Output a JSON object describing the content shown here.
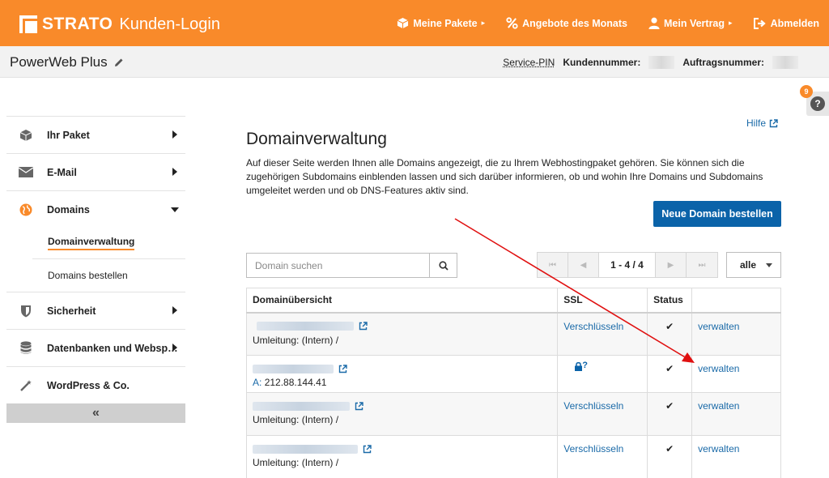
{
  "header": {
    "brand": "STRATO",
    "subtitle": "Kunden-Login",
    "nav": [
      {
        "label": "Meine Pakete",
        "icon": "package-icon",
        "has_chevron": true
      },
      {
        "label": "Angebote des Monats",
        "icon": "percent-icon",
        "has_chevron": false
      },
      {
        "label": "Mein Vertrag",
        "icon": "user-icon",
        "has_chevron": true
      },
      {
        "label": "Abmelden",
        "icon": "logout-icon",
        "has_chevron": false
      }
    ]
  },
  "subheader": {
    "product": "PowerWeb Plus",
    "service_pin": "Service-PIN",
    "customer_number_label": "Kundennummer:",
    "order_number_label": "Auftragsnummer:"
  },
  "help_widget": {
    "badge": "9",
    "icon": "?"
  },
  "sidebar": {
    "items": [
      {
        "label": "Ihr Paket",
        "icon": "cube-icon"
      },
      {
        "label": "E-Mail",
        "icon": "envelope-icon"
      },
      {
        "label": "Domains",
        "icon": "globe-icon",
        "expanded": true
      },
      {
        "label": "Sicherheit",
        "icon": "shield-icon"
      },
      {
        "label": "Datenbanken und Websp…",
        "icon": "database-icon"
      },
      {
        "label": "WordPress & Co.",
        "icon": "magic-wand-icon"
      }
    ],
    "domains_sub": [
      {
        "label": "Domainverwaltung",
        "active": true
      },
      {
        "label": "Domains bestellen",
        "active": false
      }
    ],
    "collapse_label": "«"
  },
  "main": {
    "help_link": "Hilfe",
    "title": "Domainverwaltung",
    "description": "Auf dieser Seite werden Ihnen alle Domains angezeigt, die zu Ihrem Webhostingpaket gehören. Sie können sich die zugehörigen Subdomains einblenden lassen und sich darüber informieren, ob und wohin Ihre Domains und Subdomains umgeleitet werden und ob DNS-Features aktiv sind.",
    "order_button": "Neue Domain bestellen",
    "search_placeholder": "Domain suchen",
    "pager_info": "1 - 4 / 4",
    "filter_value": "alle",
    "table": {
      "headers": [
        "Domainübersicht",
        "SSL",
        "Status",
        ""
      ],
      "rows": [
        {
          "sub_label": "",
          "sub_text": "Umleitung: (Intern) /",
          "ssl": "Verschlüsseln",
          "ssl_type": "link",
          "status": "✔",
          "action": "verwalten"
        },
        {
          "sub_label": "A:",
          "sub_text": "212.88.144.41",
          "ssl": "",
          "ssl_type": "lock",
          "status": "✔",
          "action": "verwalten"
        },
        {
          "sub_label": "",
          "sub_text": "Umleitung: (Intern) /",
          "ssl": "Verschlüsseln",
          "ssl_type": "link",
          "status": "✔",
          "action": "verwalten"
        },
        {
          "sub_label": "",
          "sub_text": "Umleitung: (Intern) /",
          "ssl": "Verschlüsseln",
          "ssl_type": "link",
          "status": "✔",
          "action": "verwalten"
        }
      ]
    }
  },
  "colors": {
    "brand_orange": "#f98a2a",
    "link_blue": "#1a6aa8",
    "button_blue": "#0b63a9",
    "annotation_red": "#e01010"
  }
}
